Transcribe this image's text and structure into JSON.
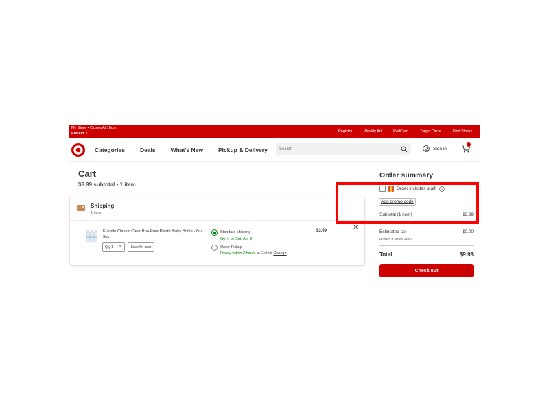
{
  "topbar": {
    "store_line1": "My Store • Closes At 10pm",
    "store_line2": "Enfield",
    "links": [
      "Registry",
      "Weekly Ad",
      "RedCard",
      "Target Circle",
      "Find Stores"
    ]
  },
  "header": {
    "nav": [
      "Categories",
      "Deals",
      "What's New",
      "Pickup & Delivery"
    ],
    "search_placeholder": "Search",
    "signin_label": "Sign in",
    "cart_count": "1"
  },
  "cart": {
    "title": "Cart",
    "subtitle": "$3.99 subtotal • 1 item"
  },
  "shipping": {
    "title": "Shipping",
    "count": "1 item",
    "product_name": "Evenflo Classic Clear Bpa-Free Plastic Baby Bottle - 8oz 3pk",
    "qty_label": "Qty 1",
    "save_label": "Save for later",
    "price": "$3.99",
    "options": {
      "standard_label": "Standard shipping",
      "standard_detail": "Get it by Sat, Apr 9",
      "pickup_label": "Order Pickup",
      "pickup_detail_green": "Ready within 2 hours",
      "pickup_detail_at": " at Enfield ",
      "pickup_change": "Change"
    }
  },
  "summary": {
    "title": "Order summary",
    "gift_label": "Order includes a gift",
    "promo_label": "Add promo code",
    "subtotal_label": "Subtotal (1 item)",
    "subtotal_value": "$3.99",
    "tax_label": "Estimated tax",
    "tax_value": "$0.00",
    "tax_note": "Delivery & tax for 01057",
    "total_label": "Total",
    "total_value": "$9.98",
    "checkout_label": "Check out"
  },
  "colors": {
    "brand_red": "#cc0000",
    "green": "#008300",
    "highlight": "#ff0000"
  }
}
